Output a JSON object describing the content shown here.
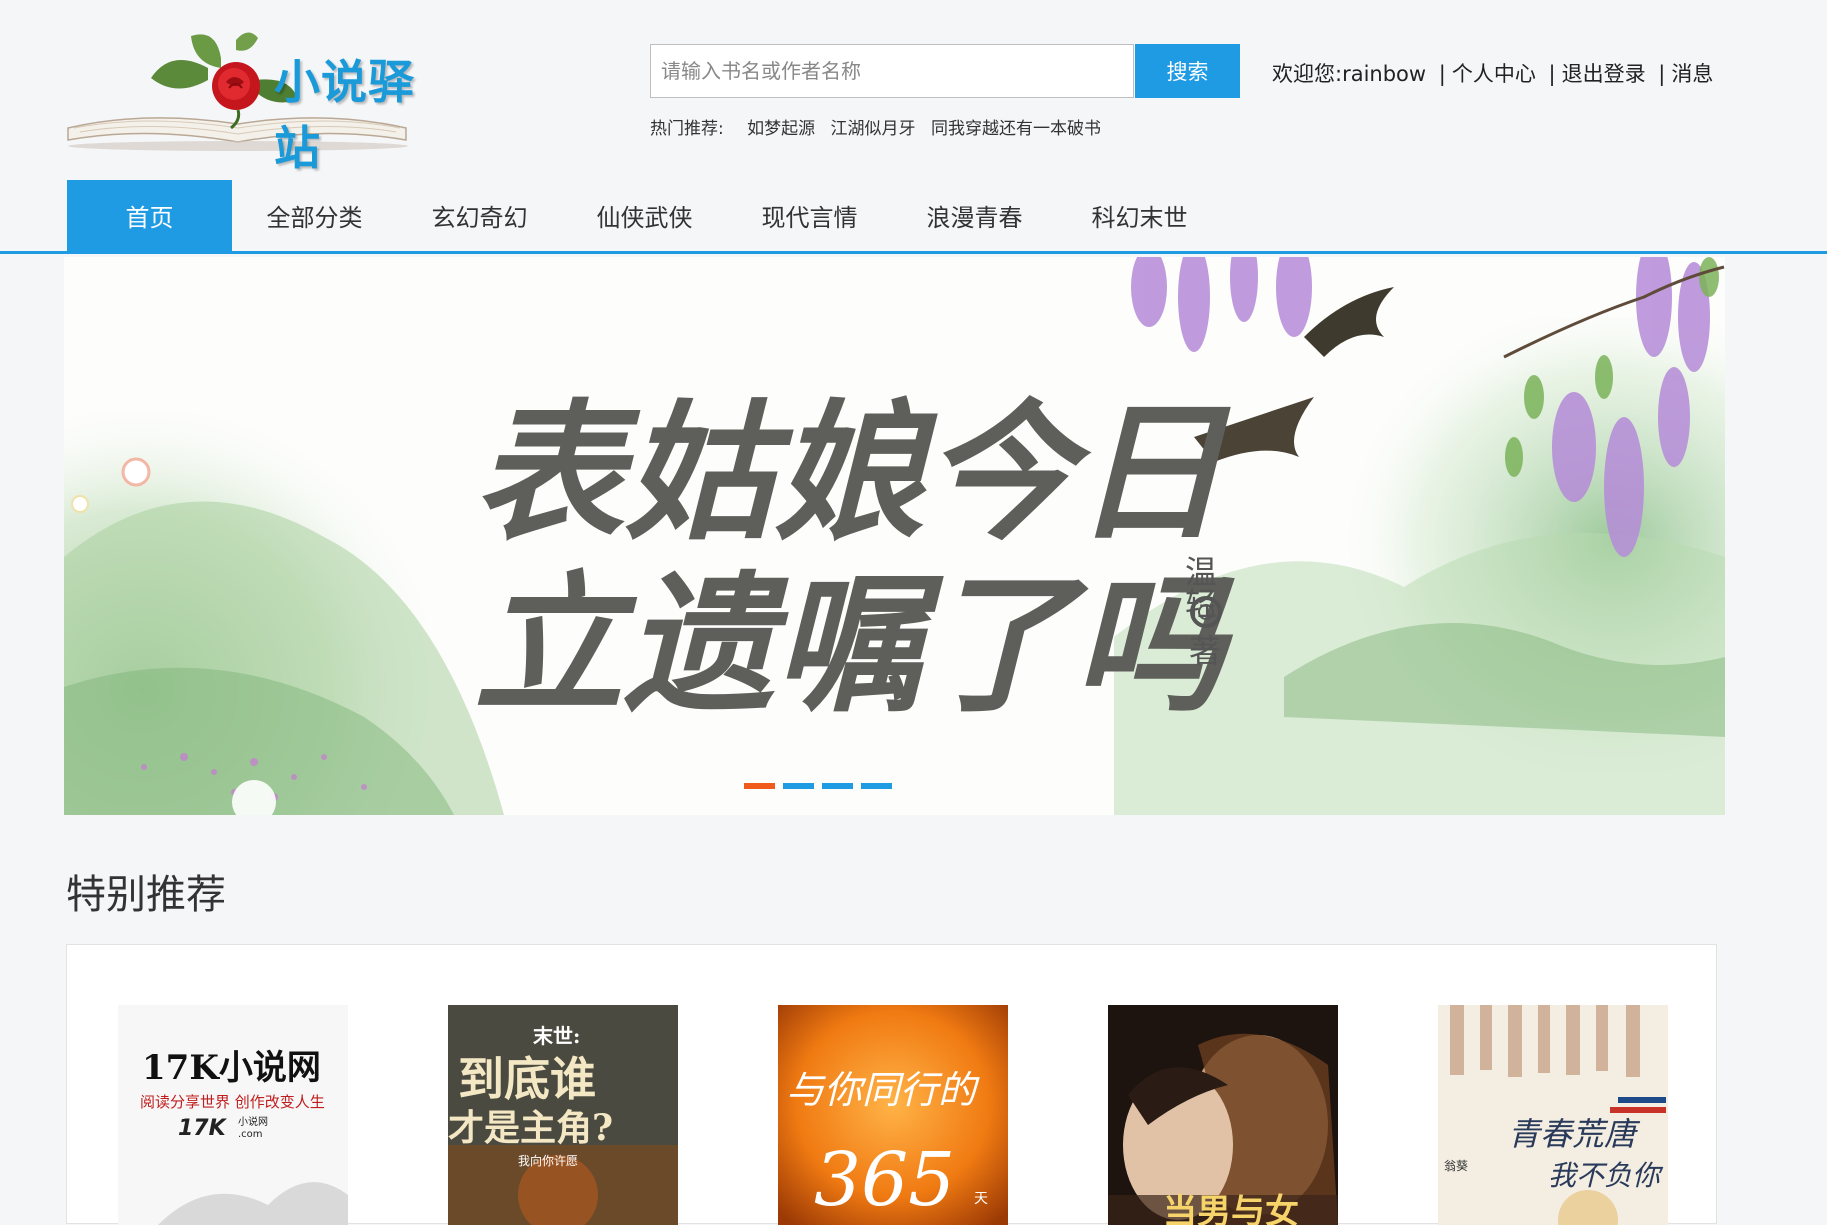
{
  "header": {
    "logo_text": "小说驿站",
    "search": {
      "placeholder": "请输入书名或作者名称",
      "button_label": "搜索"
    },
    "hot": {
      "label": "热门推荐:",
      "items": [
        "如梦起源",
        "江湖似月牙",
        "同我穿越还有一本破书"
      ]
    },
    "user": {
      "welcome": "欢迎您:",
      "username": "rainbow",
      "separator": "|",
      "profile": "个人中心",
      "logout": "退出登录",
      "messages": "消息"
    }
  },
  "nav": {
    "items": [
      "首页",
      "全部分类",
      "玄幻奇幻",
      "仙侠武侠",
      "现代言情",
      "浪漫青春",
      "科幻末世"
    ],
    "active_index": 0
  },
  "banner": {
    "title_line1": "表姑娘今日",
    "title_line2": "立遗嘱了吗",
    "author": "温轻",
    "author_suffix": "著",
    "slide_count": 4,
    "active_slide": 0
  },
  "recommend": {
    "title": "特别推荐",
    "books": [
      {
        "cover_title": "17K小说网",
        "cover_sub": "阅读分享世界 创作改变人生",
        "cover_logo": "17K",
        "cover_logo_sub": "小说网",
        "cover_logo_dom": ".com"
      },
      {
        "cover_tag": "末世:",
        "cover_title1": "到底谁",
        "cover_title2": "才是主角?",
        "cover_author": "我向你许愿"
      },
      {
        "cover_title1": "与你同行的",
        "cover_title2": "365",
        "cover_unit": "天"
      },
      {
        "cover_title": "当男与女"
      },
      {
        "cover_title1": "青春荒唐",
        "cover_title2": "我不负你",
        "cover_author": "翁葵"
      }
    ]
  },
  "colors": {
    "accent": "#1e9be3",
    "active_dot": "#f05a1c",
    "logo": "#1a9ad9"
  }
}
